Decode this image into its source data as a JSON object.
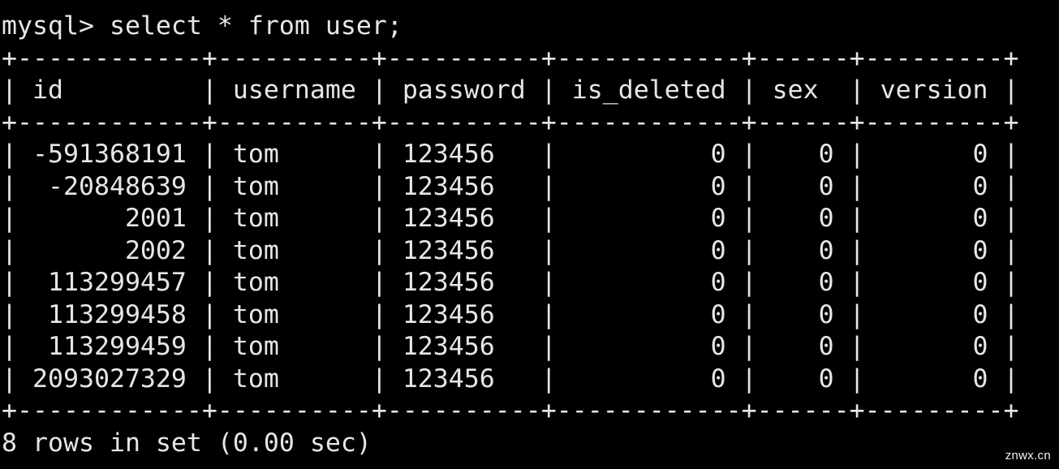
{
  "terminal": {
    "background_color": "#000000",
    "text_color": "#e6e6e6",
    "prompt": "mysql> ",
    "command": "select * from user;",
    "prompt_line": "mysql> select * from user;"
  },
  "table": {
    "columns": [
      {
        "name": "id",
        "width": 12,
        "align": "right"
      },
      {
        "name": "username",
        "width": 10,
        "align": "left"
      },
      {
        "name": "password",
        "width": 10,
        "align": "left"
      },
      {
        "name": "is_deleted",
        "width": 12,
        "align": "right"
      },
      {
        "name": "sex",
        "width": 6,
        "align": "right"
      },
      {
        "name": "version",
        "width": 9,
        "align": "right"
      }
    ],
    "headers": [
      "id",
      "username",
      "password",
      "is_deleted",
      "sex",
      "version"
    ],
    "separator": "+------------+----------+----------+------------+------+---------+",
    "header_row": "| id         | username | password | is_deleted | sex  | version |",
    "rows": [
      {
        "id": "-591368191",
        "username": "tom",
        "password": "123456",
        "is_deleted": "0",
        "sex": "0",
        "version": "0"
      },
      {
        "id": "-20848639",
        "username": "tom",
        "password": "123456",
        "is_deleted": "0",
        "sex": "0",
        "version": "0"
      },
      {
        "id": "2001",
        "username": "tom",
        "password": "123456",
        "is_deleted": "0",
        "sex": "0",
        "version": "0"
      },
      {
        "id": "2002",
        "username": "tom",
        "password": "123456",
        "is_deleted": "0",
        "sex": "0",
        "version": "0"
      },
      {
        "id": "113299457",
        "username": "tom",
        "password": "123456",
        "is_deleted": "0",
        "sex": "0",
        "version": "0"
      },
      {
        "id": "113299458",
        "username": "tom",
        "password": "123456",
        "is_deleted": "0",
        "sex": "0",
        "version": "0"
      },
      {
        "id": "113299459",
        "username": "tom",
        "password": "123456",
        "is_deleted": "0",
        "sex": "0",
        "version": "0"
      },
      {
        "id": "2093027329",
        "username": "tom",
        "password": "123456",
        "is_deleted": "0",
        "sex": "0",
        "version": "0"
      }
    ],
    "row_lines": [
      "| -591368191 | tom      | 123456   |          0 |    0 |       0 |",
      "|  -20848639 | tom      | 123456   |          0 |    0 |       0 |",
      "|       2001 | tom      | 123456   |          0 |    0 |       0 |",
      "|       2002 | tom      | 123456   |          0 |    0 |       0 |",
      "|  113299457 | tom      | 123456   |          0 |    0 |       0 |",
      "|  113299458 | tom      | 123456   |          0 |    0 |       0 |",
      "|  113299459 | tom      | 123456   |          0 |    0 |       0 |",
      "| 2093027329 | tom      | 123456   |          0 |    0 |       0 |"
    ]
  },
  "result_status": {
    "row_count": 8,
    "duration": "0.00 sec",
    "text": "8 rows in set (0.00 sec)"
  },
  "watermark": {
    "text": "znwx.cn"
  }
}
